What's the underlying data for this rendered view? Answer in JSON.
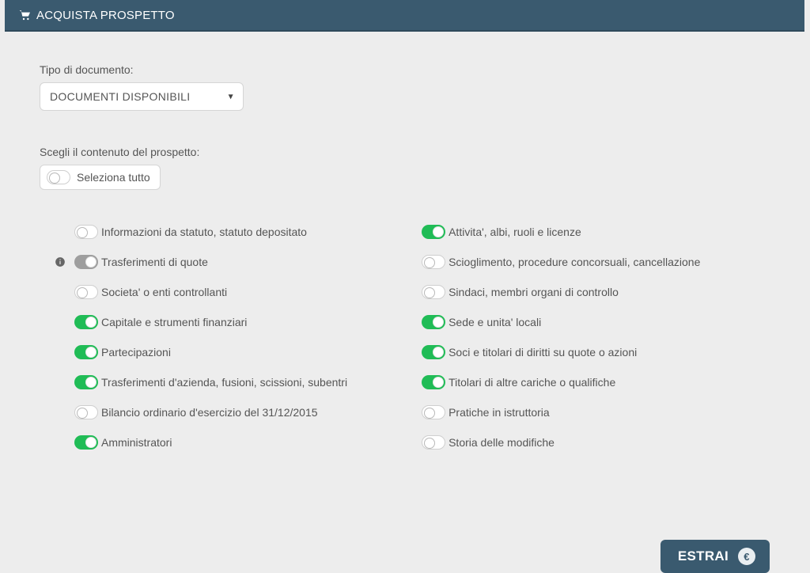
{
  "header": {
    "title": "ACQUISTA PROSPETTO"
  },
  "doc_type": {
    "label": "Tipo di documento:",
    "selected": "DOCUMENTI DISPONIBILI"
  },
  "content_section": {
    "label": "Scegli il contenuto del prospetto:",
    "select_all": "Seleziona tutto"
  },
  "left_options": [
    {
      "label": "Informazioni da statuto, statuto depositato",
      "state": "off",
      "info": false
    },
    {
      "label": "Trasferimenti di quote",
      "state": "disabled",
      "info": true
    },
    {
      "label": "Societa' o enti controllanti",
      "state": "off",
      "info": false
    },
    {
      "label": "Capitale e strumenti finanziari",
      "state": "on",
      "info": false
    },
    {
      "label": "Partecipazioni",
      "state": "on",
      "info": false
    },
    {
      "label": "Trasferimenti d'azienda, fusioni, scissioni, subentri",
      "state": "on",
      "info": false
    },
    {
      "label": "Bilancio ordinario d'esercizio del 31/12/2015",
      "state": "off",
      "info": false
    },
    {
      "label": "Amministratori",
      "state": "on",
      "info": false
    }
  ],
  "right_options": [
    {
      "label": "Attivita', albi, ruoli e licenze",
      "state": "on"
    },
    {
      "label": "Scioglimento, procedure concorsuali, cancellazione",
      "state": "off"
    },
    {
      "label": "Sindaci, membri organi di controllo",
      "state": "off"
    },
    {
      "label": "Sede e unita' locali",
      "state": "on"
    },
    {
      "label": "Soci e titolari di diritti su quote o azioni",
      "state": "on"
    },
    {
      "label": "Titolari di altre cariche o qualifiche",
      "state": "on"
    },
    {
      "label": "Pratiche in istruttoria",
      "state": "off"
    },
    {
      "label": "Storia delle modifiche",
      "state": "off"
    }
  ],
  "footer": {
    "extract_label": "ESTRAI",
    "currency_symbol": "€"
  }
}
